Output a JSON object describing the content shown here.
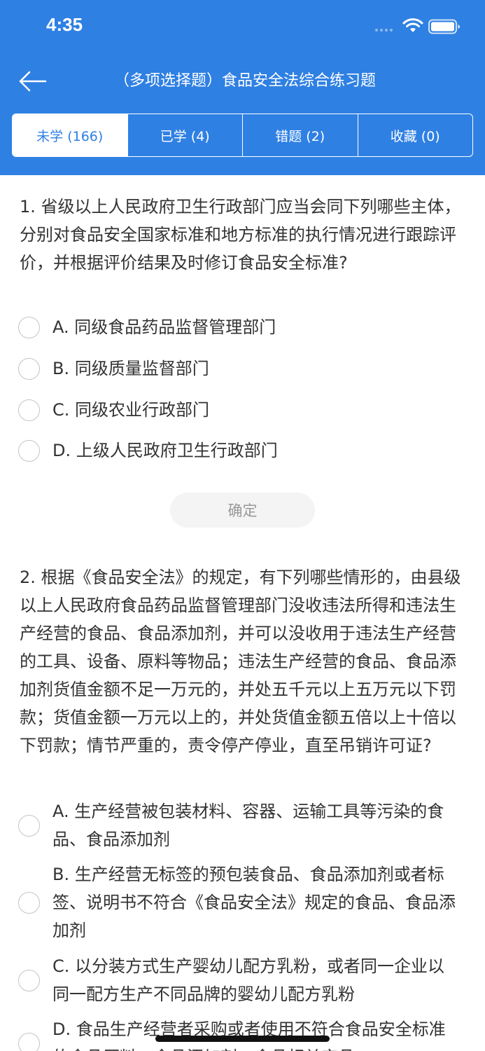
{
  "status_bar": {
    "time": "4:35"
  },
  "header": {
    "title": "（多项选择题）食品安全法综合练习题",
    "tabs": [
      {
        "label": "未学 (166)",
        "active": true
      },
      {
        "label": "已学 (4)",
        "active": false
      },
      {
        "label": "错题 (2)",
        "active": false
      },
      {
        "label": "收藏 (0)",
        "active": false
      }
    ]
  },
  "questions": [
    {
      "text": "1. 省级以上人民政府卫生行政部门应当会同下列哪些主体，分别对食品安全国家标准和地方标准的执行情况进行跟踪评价，并根据评价结果及时修订食品安全标准?",
      "options": [
        "A. 同级食品药品监督管理部门",
        "B. 同级质量监督部门",
        "C. 同级农业行政部门",
        "D. 上级人民政府卫生行政部门"
      ],
      "confirm_label": "确定"
    },
    {
      "text": "2. 根据《食品安全法》的规定，有下列哪些情形的，由县级以上人民政府食品药品监督管理部门没收违法所得和违法生产经营的食品、食品添加剂，并可以没收用于违法生产经营的工具、设备、原料等物品；违法生产经营的食品、食品添加剂货值金额不足一万元的，并处五千元以上五万元以下罚款；货值金额一万元以上的，并处货值金额五倍以上十倍以下罚款；情节严重的，责令停产停业，直至吊销许可证?",
      "options": [
        "A. 生产经营被包装材料、容器、运输工具等污染的食品、食品添加剂",
        "B. 生产经营无标签的预包装食品、食品添加剂或者标签、说明书不符合《食品安全法》规定的食品、食品添加剂",
        "C. 以分装方式生产婴幼儿配方乳粉，或者同一企业以同一配方生产不同品牌的婴幼儿配方乳粉",
        "D. 食品生产经营者采购或者使用不符合食品安全标准的食品原料、食品添加剂、食品相关产品"
      ]
    }
  ]
}
